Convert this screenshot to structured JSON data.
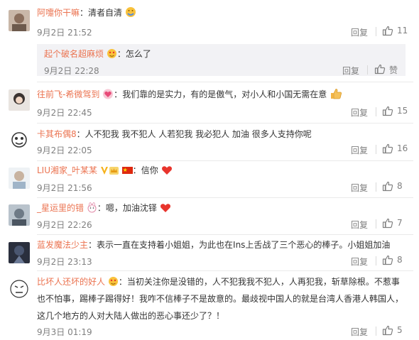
{
  "clipped_top_text": "·· · ·",
  "comments": [
    {
      "user": "阿嚏你干嘛",
      "text": "清者自清",
      "time": "9月2日 21:52",
      "reply": "回复",
      "likes": "11"
    },
    {
      "user": "起个破名超麻烦",
      "text": "怎么了",
      "time": "9月2日 22:28",
      "reply": "回复",
      "likes": "赞"
    },
    {
      "user": "往前飞-希微驾到",
      "text": "我们靠的是实力，有的是傲气，对小人和小国无需在意",
      "time": "9月2日 22:45",
      "reply": "回复",
      "likes": "15"
    },
    {
      "user": "卡其布偶8",
      "text": "人不犯我 我不犯人 人若犯我 我必犯人 加油 很多人支持你呢",
      "time": "9月2日 22:05",
      "reply": "回复",
      "likes": "16"
    },
    {
      "user": "LIU湘家_叶某某",
      "text": "信你",
      "time": "9月2日 21:56",
      "reply": "回复",
      "likes": "8"
    },
    {
      "user": "_星运里的错",
      "text": "嗯，加油沈铎",
      "time": "9月2日 22:26",
      "reply": "回复",
      "likes": "7"
    },
    {
      "user": "蓝发魔法少主",
      "text": "表示一直在支持着小姐姐，为此也在Ins上舌战了三个恶心的棒子。小姐姐加油",
      "time": "9月2日 23:13",
      "reply": "回复",
      "likes": "8"
    },
    {
      "user": "比坏人还坏的好人",
      "text_line1": "当初关注你是没错的，人不犯我我不犯人，人再犯我，斩草除根。不惹事",
      "text_line2": "也不怕事，踢棒子踢得好！我咋不信棒子不是故意的。最歧视中国人的就是台湾人香港人韩国人，",
      "text_line3": "这几个地方的人对大陆人做出的恶心事还少了？！",
      "time": "9月3日 01:19",
      "reply": "回复",
      "likes": "5"
    }
  ],
  "colors": {
    "username": "#eb7350",
    "text": "#333333",
    "meta": "#808080",
    "subbox": "#f2f2f5",
    "heart": "#e8342c"
  },
  "icons": [
    "thumbs-up-icon",
    "heart-icon",
    "emoji-face-icon",
    "china-flag-icon",
    "vip-v-icon",
    "crown-icon"
  ]
}
